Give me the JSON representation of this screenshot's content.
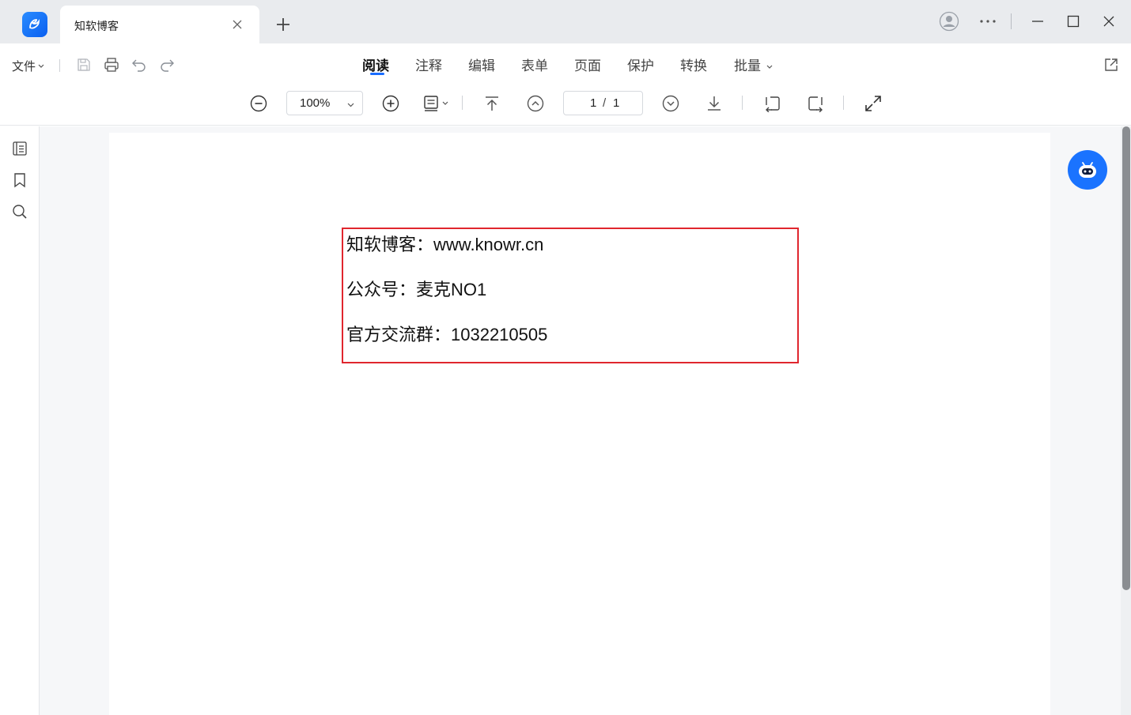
{
  "titlebar": {
    "tab_title": "知软博客",
    "add_tab": "+"
  },
  "menubar": {
    "file": "文件",
    "tabs": [
      "阅读",
      "注释",
      "编辑",
      "表单",
      "页面",
      "保护",
      "转换",
      "批量"
    ],
    "active_tab": "阅读"
  },
  "toolbar": {
    "zoom": "100%",
    "page_current": "1",
    "page_separator": "/",
    "page_total": "1"
  },
  "document": {
    "lines": [
      "知软博客：www.knowr.cn",
      "公众号：麦克NO1",
      "官方交流群：1032210505"
    ]
  },
  "colors": {
    "accent": "#1a6dff",
    "textbox_border": "#e0262e",
    "ai_button": "#1a73ff"
  },
  "icons": {
    "app": "app-logo-icon",
    "user": "user-avatar-icon",
    "more": "more-icon",
    "minimize": "minimize-icon",
    "maximize": "maximize-icon",
    "close": "close-icon"
  }
}
